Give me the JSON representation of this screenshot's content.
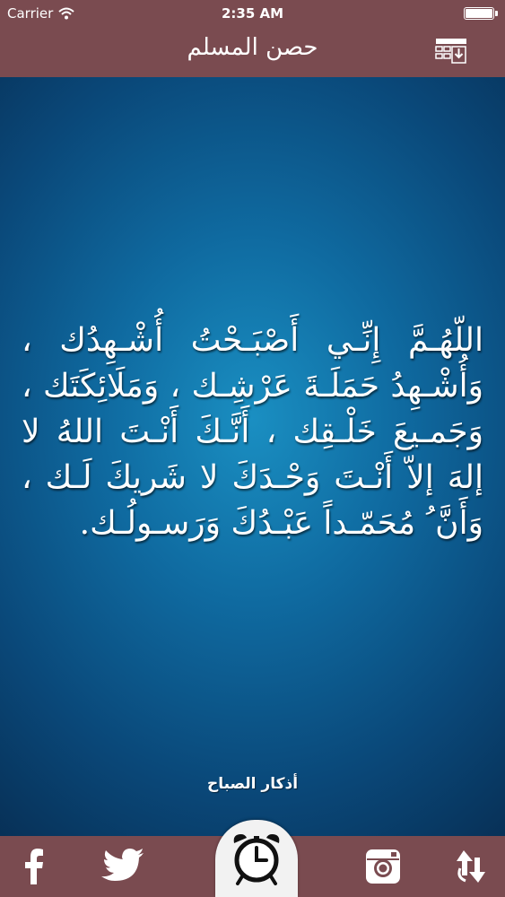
{
  "status_bar": {
    "carrier": "Carrier",
    "time": "2:35 AM"
  },
  "nav": {
    "title": "حصن المسلم",
    "menu_icon": "list-download-icon"
  },
  "content": {
    "dua_text": "اللّهُـمَّ إِنِّـي أَصْبَـحْتُ أُشْـهِدُك ، وَأُشْـهِدُ حَمَلَـةَ عَرْشِـك ، وَمَلَائِكَتَك ، وَجَمـيعَ خَلْـقِك ، أَنَّـكَ أَنْـتَ اللهُ لا إلهَ إلاّ أَنْـتَ وَحْـدَكَ لا شَريكَ لَـك ، وَأَنَّ ُ مُحَمّـداً عَبْـدُكَ وَرَسـولُـك.",
    "section_label": "أذكار الصباح",
    "background_colors": [
      "#1a8fc2",
      "#0a4879",
      "#072f55"
    ]
  },
  "tabbar": {
    "background": "#7a4b50",
    "items": [
      {
        "icon": "facebook-icon"
      },
      {
        "icon": "twitter-icon"
      },
      {
        "icon": "alarm-clock-icon"
      },
      {
        "icon": "instagram-icon"
      },
      {
        "icon": "share-arrows-icon"
      }
    ]
  }
}
